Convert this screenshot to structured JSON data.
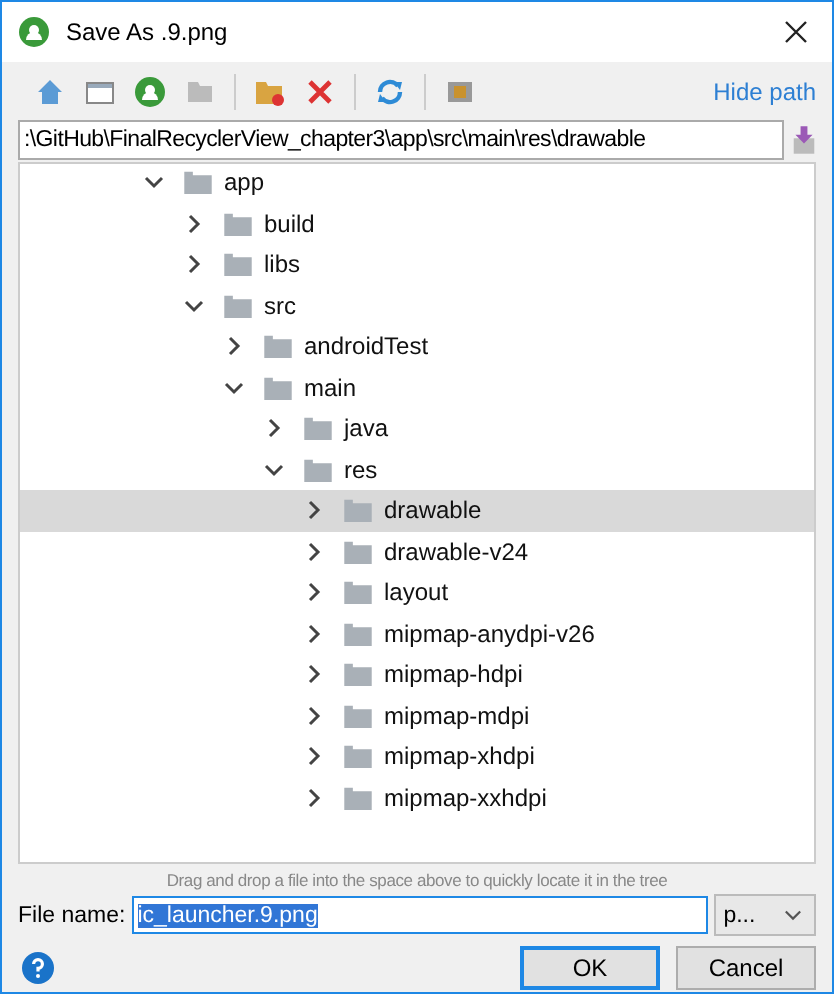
{
  "window": {
    "title": "Save As .9.png"
  },
  "toolbar": {
    "hide_path_link": "Hide path"
  },
  "path_field": {
    "value": ":\\GitHub\\FinalRecyclerView_chapter3\\app\\src\\main\\res\\drawable"
  },
  "tree": [
    {
      "label": "app",
      "expanded": true,
      "selected": false,
      "children": [
        {
          "label": "build",
          "expanded": false,
          "selected": false
        },
        {
          "label": "libs",
          "expanded": false,
          "selected": false
        },
        {
          "label": "src",
          "expanded": true,
          "selected": false,
          "children": [
            {
              "label": "androidTest",
              "expanded": false,
              "selected": false
            },
            {
              "label": "main",
              "expanded": true,
              "selected": false,
              "children": [
                {
                  "label": "java",
                  "expanded": false,
                  "selected": false
                },
                {
                  "label": "res",
                  "expanded": true,
                  "selected": false,
                  "children": [
                    {
                      "label": "drawable",
                      "expanded": false,
                      "selected": true
                    },
                    {
                      "label": "drawable-v24",
                      "expanded": false,
                      "selected": false
                    },
                    {
                      "label": "layout",
                      "expanded": false,
                      "selected": false
                    },
                    {
                      "label": "mipmap-anydpi-v26",
                      "expanded": false,
                      "selected": false
                    },
                    {
                      "label": "mipmap-hdpi",
                      "expanded": false,
                      "selected": false
                    },
                    {
                      "label": "mipmap-mdpi",
                      "expanded": false,
                      "selected": false
                    },
                    {
                      "label": "mipmap-xhdpi",
                      "expanded": false,
                      "selected": false
                    },
                    {
                      "label": "mipmap-xxhdpi",
                      "expanded": false,
                      "selected": false
                    }
                  ]
                }
              ]
            }
          ]
        }
      ]
    }
  ],
  "hint": "Drag and drop a file into the space above to quickly locate it in the tree",
  "file_name": {
    "label": "File name:",
    "value": "ic_launcher.9.png"
  },
  "format_dropdown": {
    "value": "p..."
  },
  "buttons": [
    {
      "label": "OK",
      "default": true
    },
    {
      "label": "Cancel",
      "default": false
    }
  ]
}
